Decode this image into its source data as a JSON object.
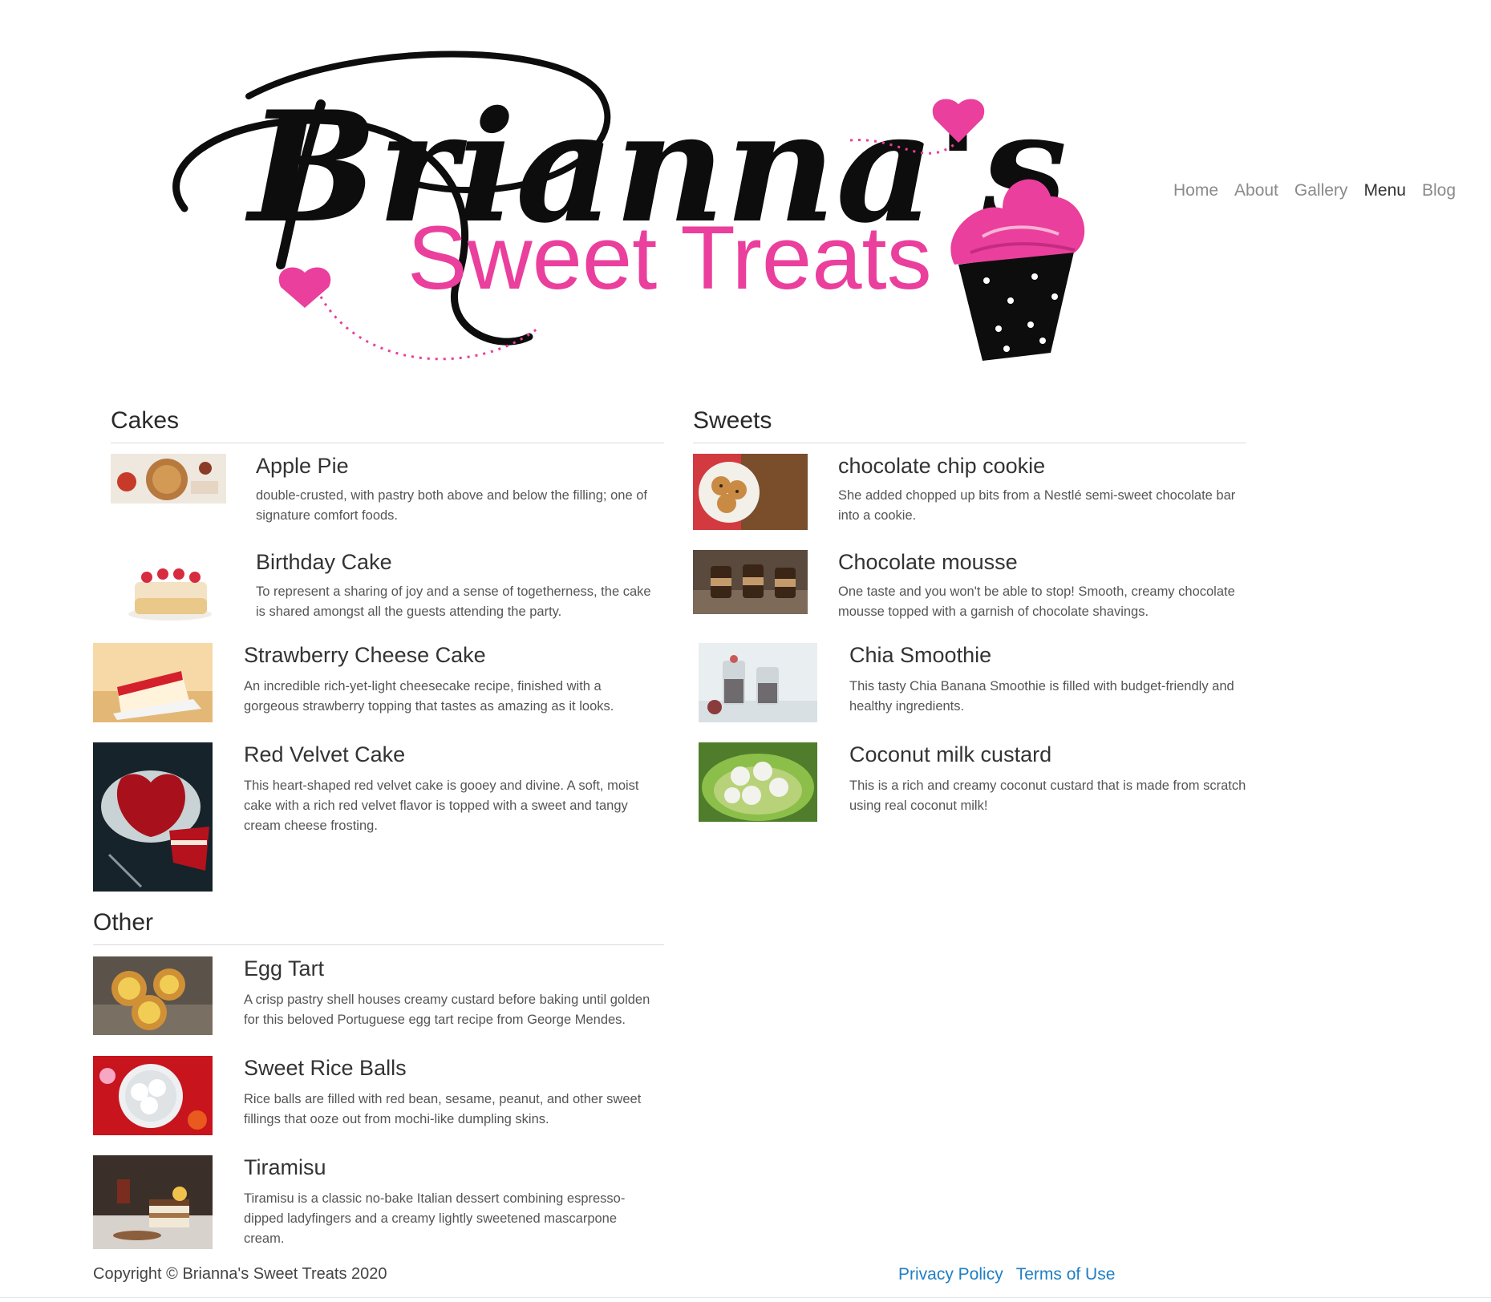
{
  "brand": {
    "script_name": "Brianna's",
    "tagline": "Sweet Treats",
    "colors": {
      "pink": "#ea3f9c",
      "ink": "#0d0d0d"
    }
  },
  "nav": {
    "items": [
      {
        "label": "Home",
        "active": false
      },
      {
        "label": "About",
        "active": false
      },
      {
        "label": "Gallery",
        "active": false
      },
      {
        "label": "Menu",
        "active": true
      },
      {
        "label": "Blog",
        "active": false
      }
    ]
  },
  "cakes": {
    "title": "Cakes",
    "items": [
      {
        "name": "Apple Pie",
        "desc": "double-crusted, with pastry both above and below the filling; one of signature comfort foods.",
        "image": "apple-pie-photo"
      },
      {
        "name": "Birthday Cake",
        "desc": "To represent a sharing of joy and a sense of togetherness, the cake is shared amongst all the guests attending the party.",
        "image": "birthday-cake-photo"
      },
      {
        "name": "Strawberry Cheese Cake",
        "desc": "An incredible rich-yet-light cheesecake recipe, finished with a gorgeous strawberry topping that tastes as amazing as it looks.",
        "image": "strawberry-cheesecake-photo"
      },
      {
        "name": "Red Velvet Cake",
        "desc": "This heart-shaped red velvet cake is gooey and divine. A soft, moist cake with a rich red velvet flavor is topped with a sweet and tangy cream cheese frosting.",
        "image": "red-velvet-cake-photo"
      }
    ]
  },
  "sweets": {
    "title": "Sweets",
    "items": [
      {
        "name": "chocolate chip cookie",
        "desc": "She added chopped up bits from a Nestlé semi-sweet chocolate bar into a cookie.",
        "image": "cookie-photo"
      },
      {
        "name": "Chocolate mousse",
        "desc": "One taste and you won't be able to stop! Smooth, creamy chocolate mousse topped with a garnish of chocolate shavings.",
        "image": "mousse-photo"
      },
      {
        "name": "Chia Smoothie",
        "desc": "This tasty Chia Banana Smoothie is filled with budget-friendly and healthy ingredients.",
        "image": "chia-smoothie-photo"
      },
      {
        "name": "Coconut milk custard",
        "desc": "This is a rich and creamy coconut custard that is made from scratch using real coconut milk!",
        "image": "coconut-custard-photo"
      }
    ]
  },
  "other": {
    "title": "Other",
    "items": [
      {
        "name": "Egg Tart",
        "desc": "A crisp pastry shell houses creamy custard before baking until golden for this beloved Portuguese egg tart recipe from George Mendes.",
        "image": "egg-tart-photo"
      },
      {
        "name": "Sweet Rice Balls",
        "desc": "Rice balls are filled with red bean, sesame, peanut, and other sweet fillings that ooze out from mochi-like dumpling skins.",
        "image": "rice-balls-photo"
      },
      {
        "name": "Tiramisu",
        "desc": "Tiramisu is a classic no-bake Italian dessert combining espresso-dipped ladyfingers and a creamy lightly sweetened mascarpone cream.",
        "image": "tiramisu-photo"
      }
    ]
  },
  "footer": {
    "copyright": "Copyright © Brianna's Sweet Treats 2020",
    "links": [
      "Privacy Policy",
      "Terms of Use"
    ]
  }
}
